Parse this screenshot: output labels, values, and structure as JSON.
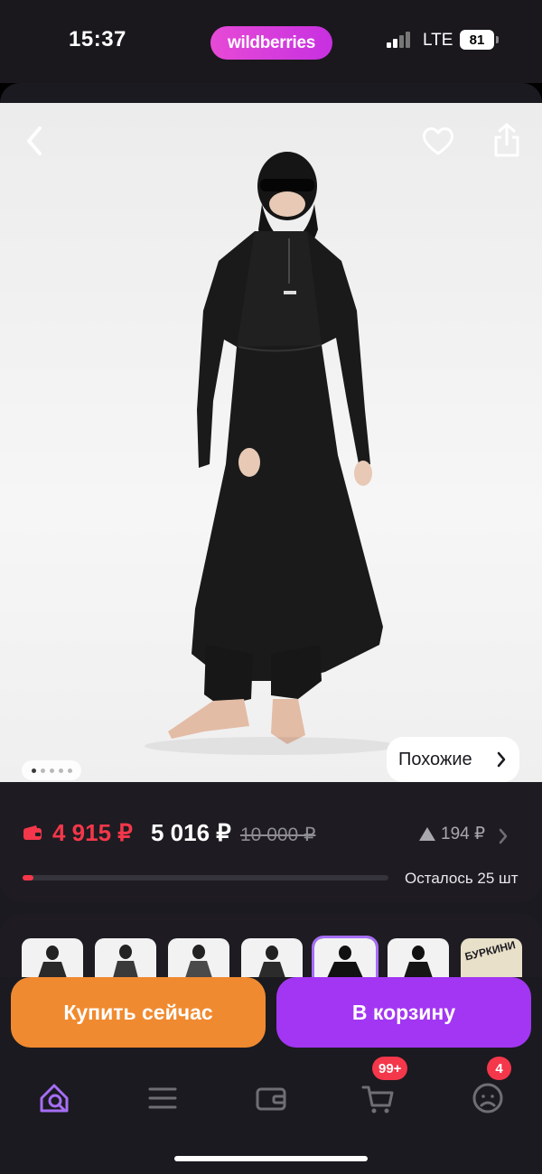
{
  "status_bar": {
    "time": "15:37",
    "network": "LTE",
    "battery": "81"
  },
  "brand": "wildberries",
  "hero": {
    "similar_label": "Похожие",
    "image_count": 5,
    "active_image": 1,
    "icons": {
      "back": "chevron-left-icon",
      "favorite": "heart-icon",
      "share": "share-icon"
    }
  },
  "price": {
    "wallet_price": "4 915 ₽",
    "price": "5 016 ₽",
    "old_price": "10 000 ₽",
    "change": "194 ₽",
    "stock_text": "Осталось 25 шт",
    "stock_fraction": 0.03
  },
  "gallery": {
    "promo_label": "БУРКИНИ",
    "selected_index": 4
  },
  "actions": {
    "buy_now": "Купить сейчас",
    "add_to_cart": "В корзину"
  },
  "nav": {
    "cart_badge": "99+",
    "profile_badge": "4",
    "icons": [
      "home-search-icon",
      "catalog-icon",
      "wallet-icon",
      "cart-icon",
      "profile-icon"
    ]
  },
  "colors": {
    "accent": "#a236f2",
    "buy": "#f08a30",
    "sale": "#f4374a",
    "background": "#1b1a20"
  }
}
